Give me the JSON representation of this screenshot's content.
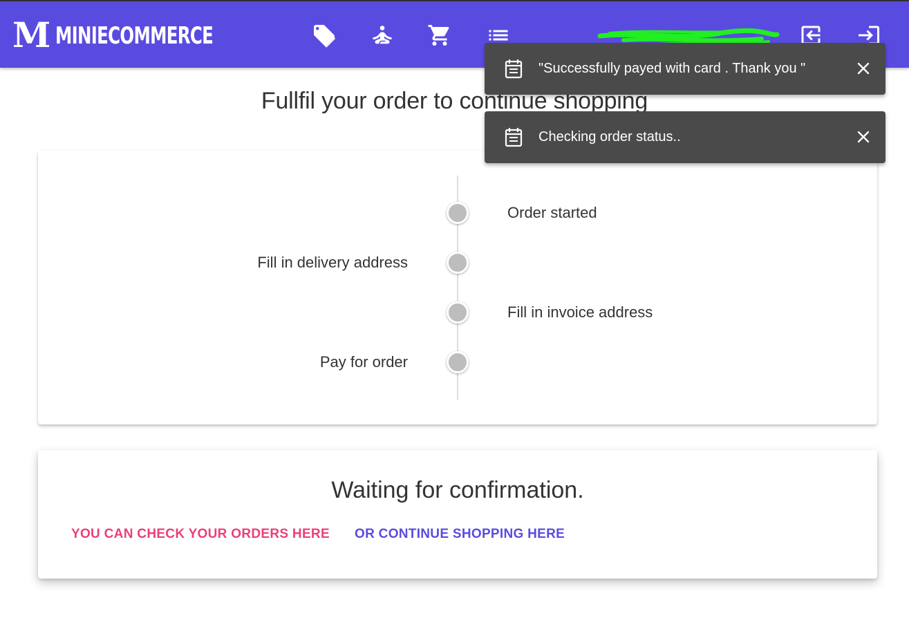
{
  "header": {
    "logo_letter": "M",
    "brand": "MINIECOMMERCE",
    "nav_icons": [
      "tag-icon",
      "meditation-icon",
      "cart-icon",
      "list-icon"
    ],
    "action_icons": [
      "logout-icon",
      "login-icon"
    ],
    "background_color": "#5a4be0"
  },
  "page": {
    "title": "Fullfil your order to continue shopping"
  },
  "timeline": {
    "steps": [
      {
        "label": "Order started",
        "side": "right"
      },
      {
        "label": "Fill in delivery address",
        "side": "left"
      },
      {
        "label": "Fill in invoice address",
        "side": "right"
      },
      {
        "label": "Pay for order",
        "side": "left"
      }
    ],
    "dot_color": "#bdbdbd"
  },
  "confirmation": {
    "title": "Waiting for confirmation.",
    "orders_link": "YOU CAN CHECK YOUR ORDERS HERE",
    "continue_link": "OR CONTINUE SHOPPING HERE",
    "orders_link_color": "#ea3f7b",
    "continue_link_color": "#5a4be0"
  },
  "toasts": [
    {
      "icon": "notes-icon",
      "message": "\"Successfully payed with card . Thank you \""
    },
    {
      "icon": "notes-icon",
      "message": "Checking order status.."
    }
  ]
}
